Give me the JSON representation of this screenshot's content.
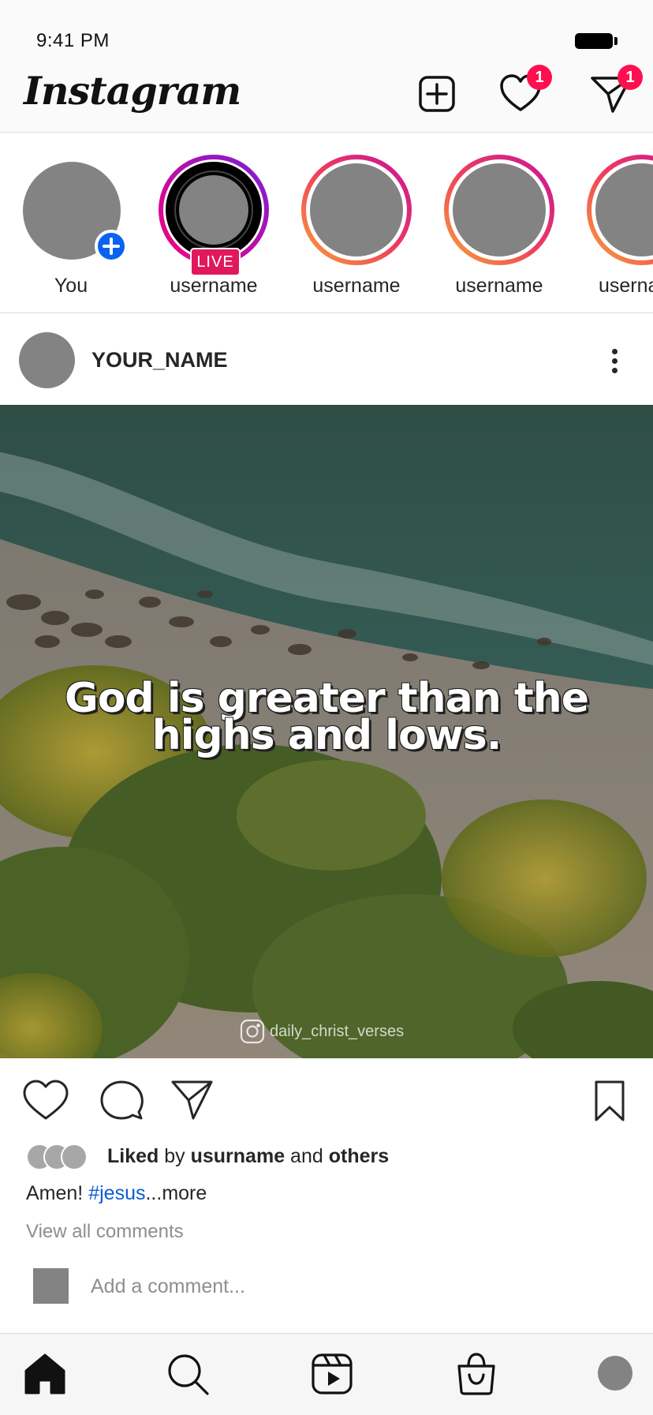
{
  "status_bar": {
    "time": "9:41 PM"
  },
  "header": {
    "logo": "Instagram",
    "notifications_badge": "1",
    "messages_badge": "1",
    "icons": [
      "new-post-icon",
      "heart-icon",
      "send-icon"
    ]
  },
  "stories": [
    {
      "label": "You",
      "type": "own"
    },
    {
      "label": "username",
      "type": "live",
      "live_label": "LIVE"
    },
    {
      "label": "username",
      "type": "ring"
    },
    {
      "label": "username",
      "type": "ring"
    },
    {
      "label": "userna",
      "type": "ring"
    }
  ],
  "post": {
    "username": "YOUR_NAME",
    "quote_line1": "God is greater than the",
    "quote_line2": "highs and lows.",
    "watermark": "daily_christ_verses",
    "liked_by_prefix": "Liked",
    "liked_by_mid": "by",
    "liked_by_user": "usurname",
    "liked_by_and": "and",
    "liked_by_others": "others",
    "caption_text": "Amen!",
    "caption_tag": "#jesus",
    "caption_more": "...more",
    "view_comments": "View all comments",
    "comment_placeholder": "Add a comment..."
  },
  "bottom_nav": {
    "items": [
      "home-icon",
      "search-icon",
      "reels-icon",
      "shop-icon",
      "profile-avatar"
    ]
  },
  "colors": {
    "accent_blue": "#0b5cd6",
    "badge_red": "#ff0f4f",
    "live_pink": "#e0195b",
    "add_story_blue": "#0a63f0"
  }
}
